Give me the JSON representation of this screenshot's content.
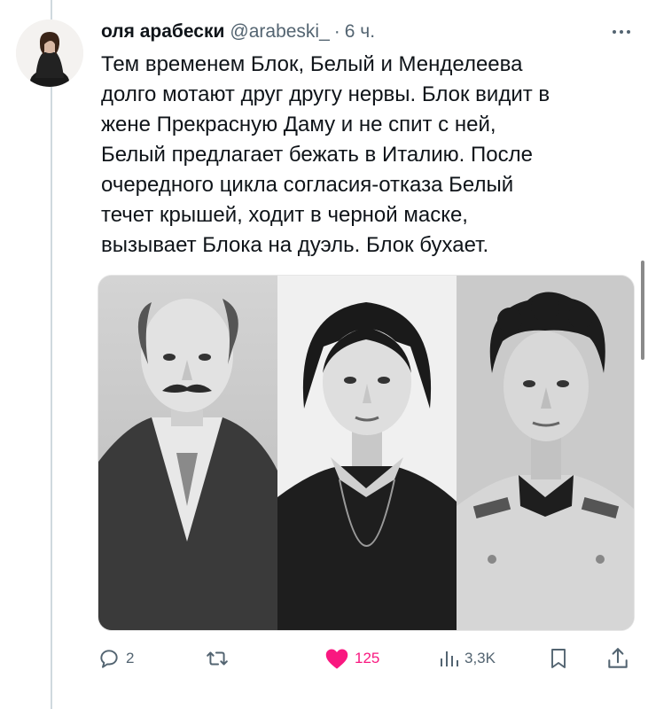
{
  "tweet": {
    "author_name": "оля арабески",
    "author_handle": "@arabeski_",
    "separator": "·",
    "time": "6 ч.",
    "text_lines": [
      "Тем временем Блок, Белый и Менделеева",
      "долго мотают друг другу нервы. Блок видит в",
      "жене Прекрасную Даму и не спит с ней,",
      "Белый предлагает бежать в Италию. После",
      "очередного цикла согласия-отказа Белый",
      "течет крышей, ходит в черной маске,",
      "вызывает Блока на дуэль. Блок бухает."
    ]
  },
  "actions": {
    "replies": "2",
    "retweets": "",
    "likes": "125",
    "views": "3,3K"
  },
  "colors": {
    "text": "#0f1419",
    "secondary": "#536471",
    "like": "#f91880",
    "thread_line": "#cfd9de"
  },
  "icons": {
    "reply": "reply-icon",
    "retweet": "retweet-icon",
    "like": "heart-icon",
    "views": "views-icon",
    "bookmark": "bookmark-icon",
    "share": "share-icon",
    "more": "more-icon"
  }
}
